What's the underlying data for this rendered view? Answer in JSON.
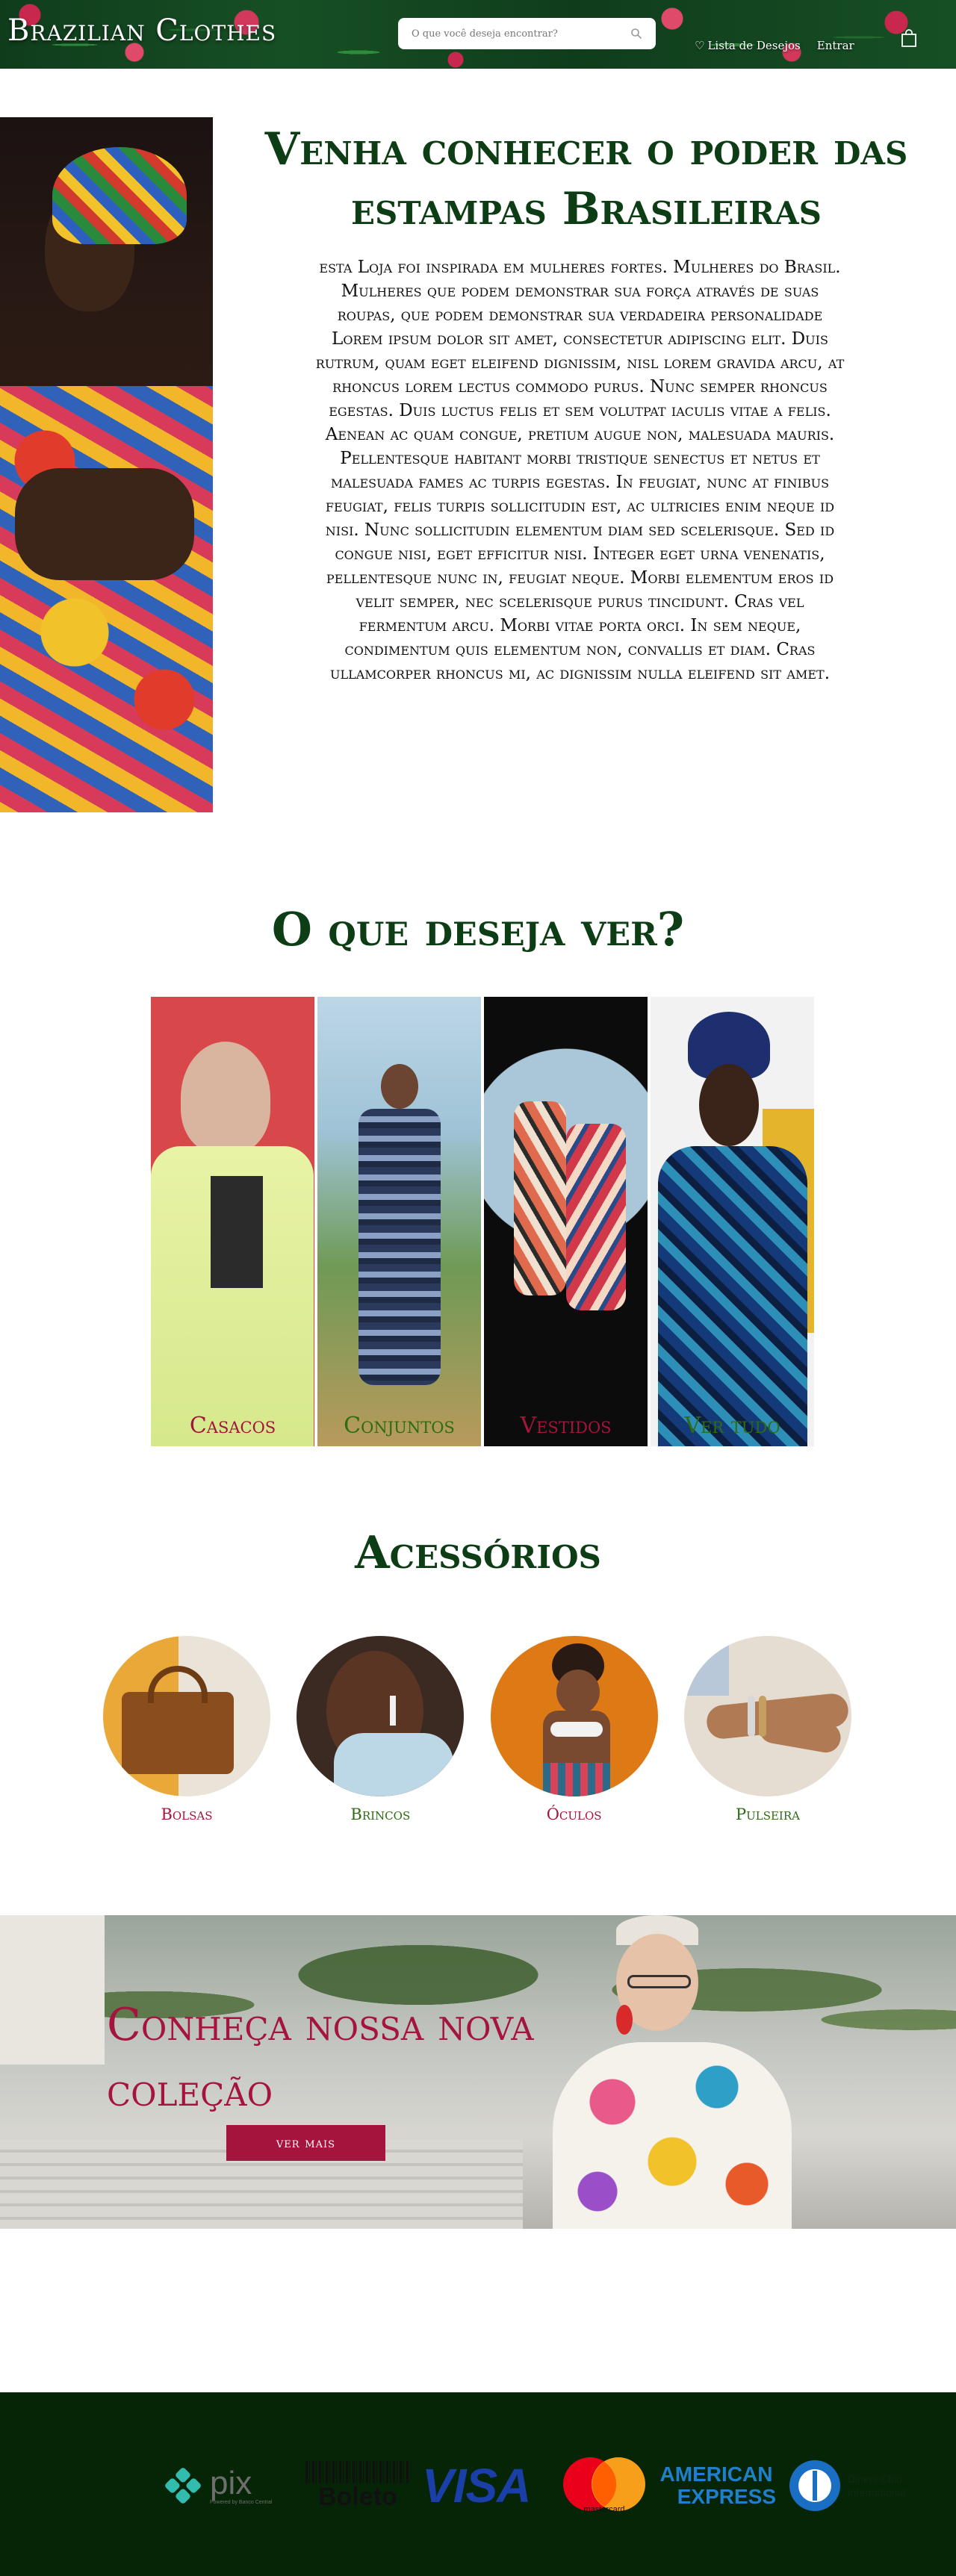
{
  "header": {
    "logo": "Brazilian Clothes",
    "search_placeholder": "O que você deseja encontrar?",
    "wishlist_label": "Lista de Desejos",
    "login_label": "Entrar"
  },
  "hero": {
    "title": "Venha conhecer o poder das estampas Brasileiras",
    "text": "esta Loja foi inspirada em mulheres fortes. Mulheres do Brasil. Mulheres que podem demonstrar sua força através de suas roupas, que podem demonstrar sua verdadeira personalidade\nLorem ipsum dolor sit amet, consectetur adipiscing elit. Duis rutrum, quam eget eleifend dignissim, nisl lorem gravida arcu, at rhoncus lorem lectus commodo purus. Nunc semper rhoncus egestas. Duis luctus felis et sem volutpat iaculis vitae a felis. Aenean ac quam congue, pretium augue non, malesuada mauris. Pellentesque habitant morbi tristique senectus et netus et malesuada fames ac turpis egestas. In feugiat, nunc at finibus feugiat, felis turpis sollicitudin est, ac ultricies enim neque id nisi. Nunc sollicitudin elementum diam sed scelerisque. Sed id congue nisi, eget efficitur nisi. Integer eget urna venenatis, pellentesque nunc in, feugiat neque. Morbi elementum eros id velit semper, nec scelerisque purus tincidunt. Cras vel fermentum arcu. Morbi vitae porta orci. In sem neque, condimentum quis elementum non, convallis et diam. Cras ullamcorper rhoncus mi, ac dignissim nulla eleifend sit amet."
  },
  "categories": {
    "title": "O que deseja ver?",
    "items": [
      {
        "label": "Casacos",
        "color": "#a4143c"
      },
      {
        "label": "Conjuntos",
        "color": "#2e6b12"
      },
      {
        "label": "Vestidos",
        "color": "#a4143c"
      },
      {
        "label": "Ver tudo",
        "color": "#2e6b12"
      }
    ]
  },
  "accessories": {
    "title": "Acessórios",
    "items": [
      {
        "label": "Bolsas",
        "color": "#a4143c"
      },
      {
        "label": "Brincos",
        "color": "#2e6b12"
      },
      {
        "label": "Óculos",
        "color": "#a4143c"
      },
      {
        "label": "Pulseira",
        "color": "#2e6b12"
      }
    ]
  },
  "banner": {
    "title": "Conheça nossa nova coleção",
    "button": "ver mais"
  },
  "footer": {
    "payments": {
      "pix": "pix",
      "pix_sub": "Powered by Banco Central",
      "boleto": "Boleto",
      "visa": "VISA",
      "mastercard": "mastercard",
      "amex_1": "AMERICAN",
      "amex_2": "EXPRESS",
      "diners": "Diners Club International"
    }
  },
  "colors": {
    "brand_green": "#0d3d14",
    "brand_red": "#a4143c",
    "footer_bg": "#062507"
  }
}
